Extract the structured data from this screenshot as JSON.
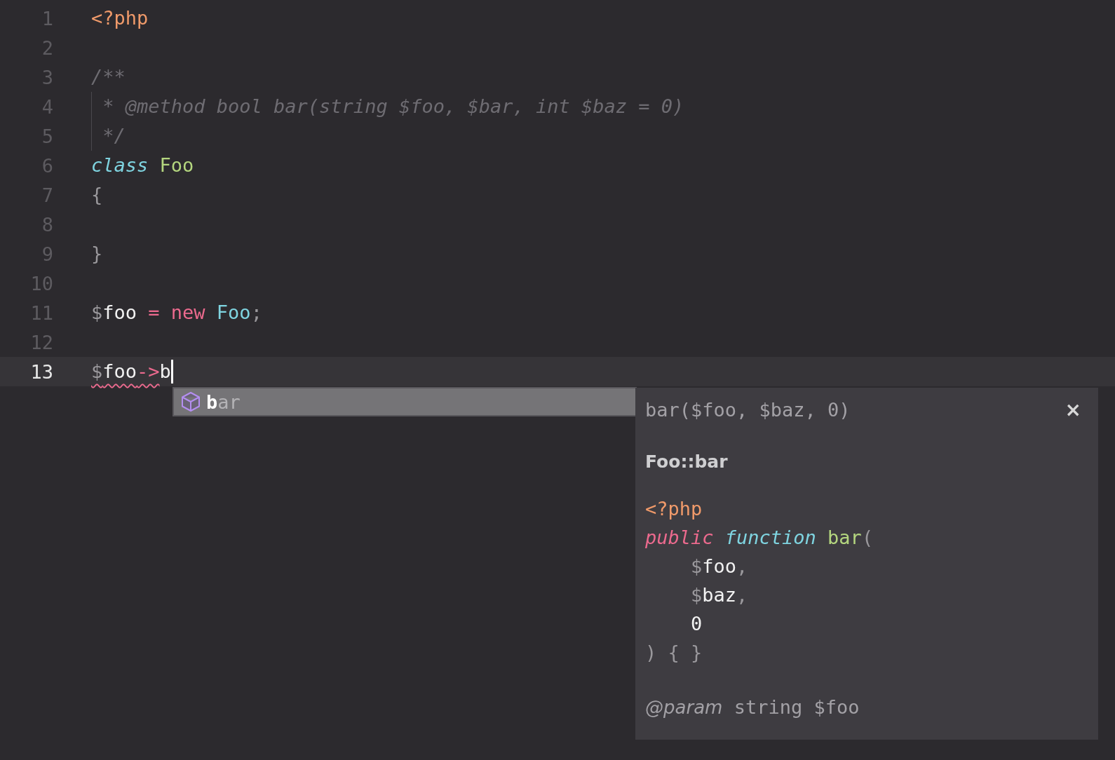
{
  "editor": {
    "lines": [
      {
        "number": "1",
        "active": false,
        "guide": false,
        "tokens": [
          {
            "text": "<?php",
            "kind": "tag"
          }
        ]
      },
      {
        "number": "2",
        "active": false
      },
      {
        "number": "3",
        "active": false,
        "guide": false,
        "tokens": [
          {
            "text": "/**",
            "kind": "comment"
          }
        ]
      },
      {
        "number": "4",
        "active": false,
        "guide": true,
        "tokens": [
          {
            "text": " * @method bool bar(string $foo, $bar, int $baz = 0)",
            "kind": "comment"
          }
        ]
      },
      {
        "number": "5",
        "active": false,
        "guide": true,
        "tokens": [
          {
            "text": " */",
            "kind": "comment"
          }
        ]
      },
      {
        "number": "6",
        "active": false,
        "guide": false,
        "tokens": [
          {
            "text": "class ",
            "kind": "storage"
          },
          {
            "text": "Foo",
            "kind": "class"
          }
        ]
      },
      {
        "number": "7",
        "active": false,
        "guide": false,
        "tokens": [
          {
            "text": "{",
            "kind": "punct"
          }
        ]
      },
      {
        "number": "8",
        "active": false
      },
      {
        "number": "9",
        "active": false,
        "guide": false,
        "tokens": [
          {
            "text": "}",
            "kind": "punct"
          }
        ]
      },
      {
        "number": "10",
        "active": false
      },
      {
        "number": "11",
        "active": false,
        "guide": false,
        "tokens": [
          {
            "text": "$",
            "kind": "sign"
          },
          {
            "text": "foo",
            "kind": "var"
          },
          {
            "text": " = new ",
            "kind": "operator"
          },
          {
            "text": "Foo",
            "kind": "classref"
          },
          {
            "text": ";",
            "kind": "punct"
          }
        ]
      },
      {
        "number": "12",
        "active": false
      },
      {
        "number": "13",
        "active": true,
        "guide": false,
        "tokens": [
          {
            "text": "$",
            "kind": "sign",
            "error": true
          },
          {
            "text": "foo",
            "kind": "var",
            "error": true
          },
          {
            "text": "->",
            "kind": "operator",
            "error": true
          },
          {
            "text": "b",
            "kind": "var",
            "error": false
          }
        ]
      }
    ]
  },
  "completion": {
    "items": [
      {
        "label": "**b**ar",
        "selected": true
      }
    ]
  },
  "docs": {
    "signature": "bar($foo, $baz, 0)",
    "close": "×",
    "title": "Foo::bar",
    "code": [
      [
        {
          "text": "<?php",
          "kind": "tag"
        }
      ],
      [
        {
          "text": "public ",
          "kind": "modifier"
        },
        {
          "text": "function ",
          "kind": "storage"
        },
        {
          "text": "bar",
          "kind": "class"
        },
        {
          "text": "(",
          "kind": "punct"
        }
      ],
      [
        {
          "text": "    $",
          "kind": "sign"
        },
        {
          "text": "foo",
          "kind": "var"
        },
        {
          "text": ",",
          "kind": "punct"
        }
      ],
      [
        {
          "text": "    $",
          "kind": "sign"
        },
        {
          "text": "baz",
          "kind": "var"
        },
        {
          "text": ",",
          "kind": "punct"
        }
      ],
      [
        {
          "text": "    0",
          "kind": "var"
        }
      ],
      [
        {
          "text": ") { }",
          "kind": "punct"
        }
      ]
    ],
    "param": {
      "tag": "@param",
      "text": "string $foo"
    }
  }
}
